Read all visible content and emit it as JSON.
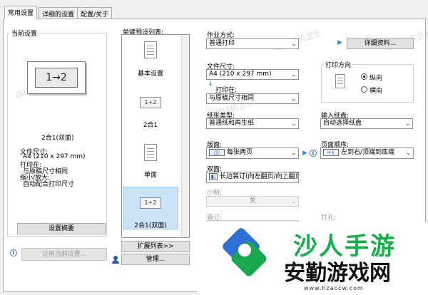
{
  "tabs": [
    "常用设置",
    "详细的设置",
    "配置/关于"
  ],
  "current_settings": {
    "title": "当前设置",
    "preview_text": "1→2",
    "caption": "2合1(双面)",
    "details": [
      "文件尺寸:",
      "A4 (210 x 297 mm)",
      "打印在:",
      "与原稿尺寸相同",
      "缩小/放大:",
      "自动配合打印尺寸"
    ],
    "summary_button": "设置摘要",
    "register_button": "注册当前设置..."
  },
  "presets": {
    "title": "单键预设列表:",
    "items": [
      "基本设置",
      "2合1",
      "单面",
      "2合1(双面)"
    ],
    "icon_text": "1+2",
    "expand_button": "扩展列表>>",
    "manage_button": "管理..."
  },
  "settings": {
    "job_type_label": "作业方式:",
    "job_type_value": "普通打印",
    "details_button": "详细资料...",
    "paper_size_label": "文件尺寸:",
    "paper_size_value": "A4 (210 x 297 mm)",
    "print_on_label": "打印在:",
    "print_on_value": "与原稿尺寸相同",
    "orientation_title": "打印方向",
    "orientation_portrait": "纵向",
    "orientation_landscape": "横向",
    "paper_type_label": "纸张类型:",
    "paper_type_value": "普通纸和再生纸",
    "input_tray_label": "输入纸盘:",
    "input_tray_value": "自动选择纸盘",
    "layout_label": "版面:",
    "layout_value": "每张两页",
    "page_order_label": "页面顺序:",
    "page_order_value": "左到右/顶端到底端",
    "duplex_label": "双面:",
    "duplex_value": "长边装订(向左翻页/向上翻页)",
    "booklet_label": "小册:",
    "booklet_value": "关",
    "binding_label": "装订:",
    "punch_label": "打孔:"
  },
  "watermark": "@打印机卫士",
  "overlay": {
    "brand_top": "沙人手游",
    "brand_main": "安勤游戏网",
    "brand_url": "www.hzaccw.com"
  },
  "colors": {
    "accent": "#3d83d9",
    "selection": "#cce4f7",
    "brand_green": "#16b04a"
  }
}
